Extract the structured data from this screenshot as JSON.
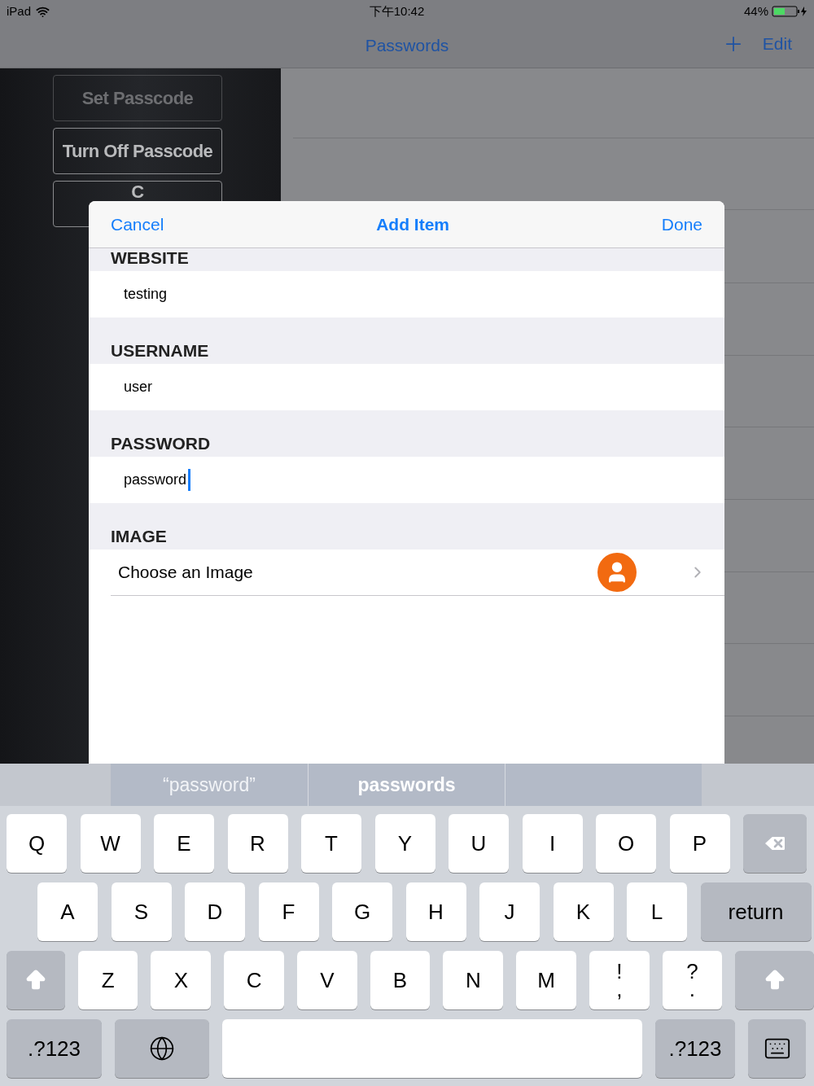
{
  "status_bar": {
    "device": "iPad",
    "time": "下午10:42",
    "battery": "44%"
  },
  "nav_bar": {
    "title": "Passwords",
    "edit": "Edit"
  },
  "side_menu": [
    {
      "label": "Set Passcode",
      "disabled": true
    },
    {
      "label": "Turn Off Passcode",
      "disabled": false
    },
    {
      "label": "C",
      "disabled": false
    }
  ],
  "dialog": {
    "cancel": "Cancel",
    "title": "Add Item",
    "done": "Done",
    "fields": [
      {
        "label": "WEBSITE",
        "value": "testing",
        "focused": false
      },
      {
        "label": "USERNAME",
        "value": "user",
        "focused": false
      },
      {
        "label": "PASSWORD",
        "value": "password",
        "focused": true
      }
    ],
    "image_section": {
      "label": "IMAGE",
      "row": "Choose an Image"
    }
  },
  "suggestions": [
    {
      "text": "“password”",
      "kind": "literal"
    },
    {
      "text": "passwords",
      "kind": "word"
    },
    {
      "kind": "empty"
    }
  ],
  "keyboard": [
    [
      {
        "kind": "letter",
        "label": "Q"
      },
      {
        "kind": "letter",
        "label": "W"
      },
      {
        "kind": "letter",
        "label": "E"
      },
      {
        "kind": "letter",
        "label": "R"
      },
      {
        "kind": "letter",
        "label": "T"
      },
      {
        "kind": "letter",
        "label": "Y"
      },
      {
        "kind": "letter",
        "label": "U"
      },
      {
        "kind": "letter",
        "label": "I"
      },
      {
        "kind": "letter",
        "label": "O"
      },
      {
        "kind": "letter",
        "label": "P"
      },
      {
        "kind": "delete"
      }
    ],
    [
      {
        "kind": "letter",
        "label": "A"
      },
      {
        "kind": "letter",
        "label": "S"
      },
      {
        "kind": "letter",
        "label": "D"
      },
      {
        "kind": "letter",
        "label": "F"
      },
      {
        "kind": "letter",
        "label": "G"
      },
      {
        "kind": "letter",
        "label": "H"
      },
      {
        "kind": "letter",
        "label": "J"
      },
      {
        "kind": "letter",
        "label": "K"
      },
      {
        "kind": "letter",
        "label": "L"
      },
      {
        "kind": "return",
        "label": "return"
      }
    ],
    [
      {
        "kind": "shift"
      },
      {
        "kind": "letter",
        "label": "Z"
      },
      {
        "kind": "letter",
        "label": "X"
      },
      {
        "kind": "letter",
        "label": "C"
      },
      {
        "kind": "letter",
        "label": "V"
      },
      {
        "kind": "letter",
        "label": "B"
      },
      {
        "kind": "letter",
        "label": "N"
      },
      {
        "kind": "letter",
        "label": "M"
      },
      {
        "kind": "punct",
        "label": "!",
        "sub": ","
      },
      {
        "kind": "punct",
        "label": "?",
        "sub": "."
      },
      {
        "kind": "shift"
      }
    ],
    [
      {
        "kind": "mode",
        "label": ".?123"
      },
      {
        "kind": "globe"
      },
      {
        "kind": "space"
      },
      {
        "kind": "mode",
        "label": ".?123"
      },
      {
        "kind": "dismiss"
      }
    ]
  ]
}
